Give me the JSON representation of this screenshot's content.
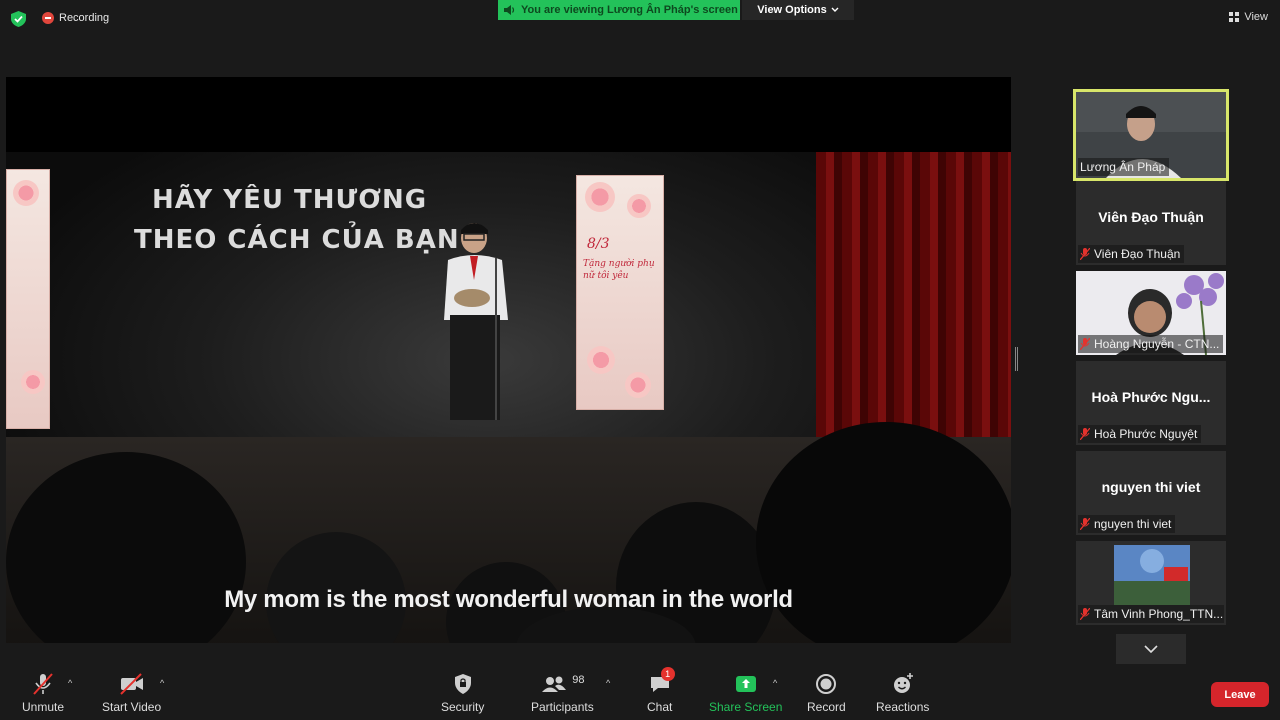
{
  "topbar": {
    "recording_label": "Recording",
    "viewing_label": "You are viewing Lương Ân Pháp's screen",
    "view_options_label": "View Options",
    "view_label": "View"
  },
  "share": {
    "backdrop_line1": "HÃY YÊU THƯƠNG",
    "backdrop_line2": "THEO CÁCH CỦA BẠN",
    "banner_title": "8/3",
    "banner_subtitle": "Tặng người phụ nữ tôi yêu",
    "caption": "My mom is the most wonderful woman in the world"
  },
  "participants": [
    {
      "name": "Lương Ân Pháp",
      "video": true,
      "active": true
    },
    {
      "display": "Viên Đạo Thuận",
      "name": "Viên Đạo Thuận",
      "video": false
    },
    {
      "name": "Hoàng Nguyễn - CTN...",
      "video": true
    },
    {
      "display": "Hoà  Phước  Ngu...",
      "name": "Hoà Phước Nguyệt",
      "video": false
    },
    {
      "display": "nguyen thi viet",
      "name": "nguyen thi viet",
      "video": false
    },
    {
      "name": "Tâm Vinh Phong_TTN...",
      "video": true
    }
  ],
  "toolbar": {
    "unmute": "Unmute",
    "start_video": "Start Video",
    "security": "Security",
    "participants": "Participants",
    "participants_count": "98",
    "chat": "Chat",
    "chat_badge": "1",
    "share_screen": "Share Screen",
    "record": "Record",
    "reactions": "Reactions",
    "leave": "Leave"
  },
  "colors": {
    "share_green": "#23c25a",
    "leave_red": "#d5252b",
    "active_border": "#d8e66a"
  }
}
